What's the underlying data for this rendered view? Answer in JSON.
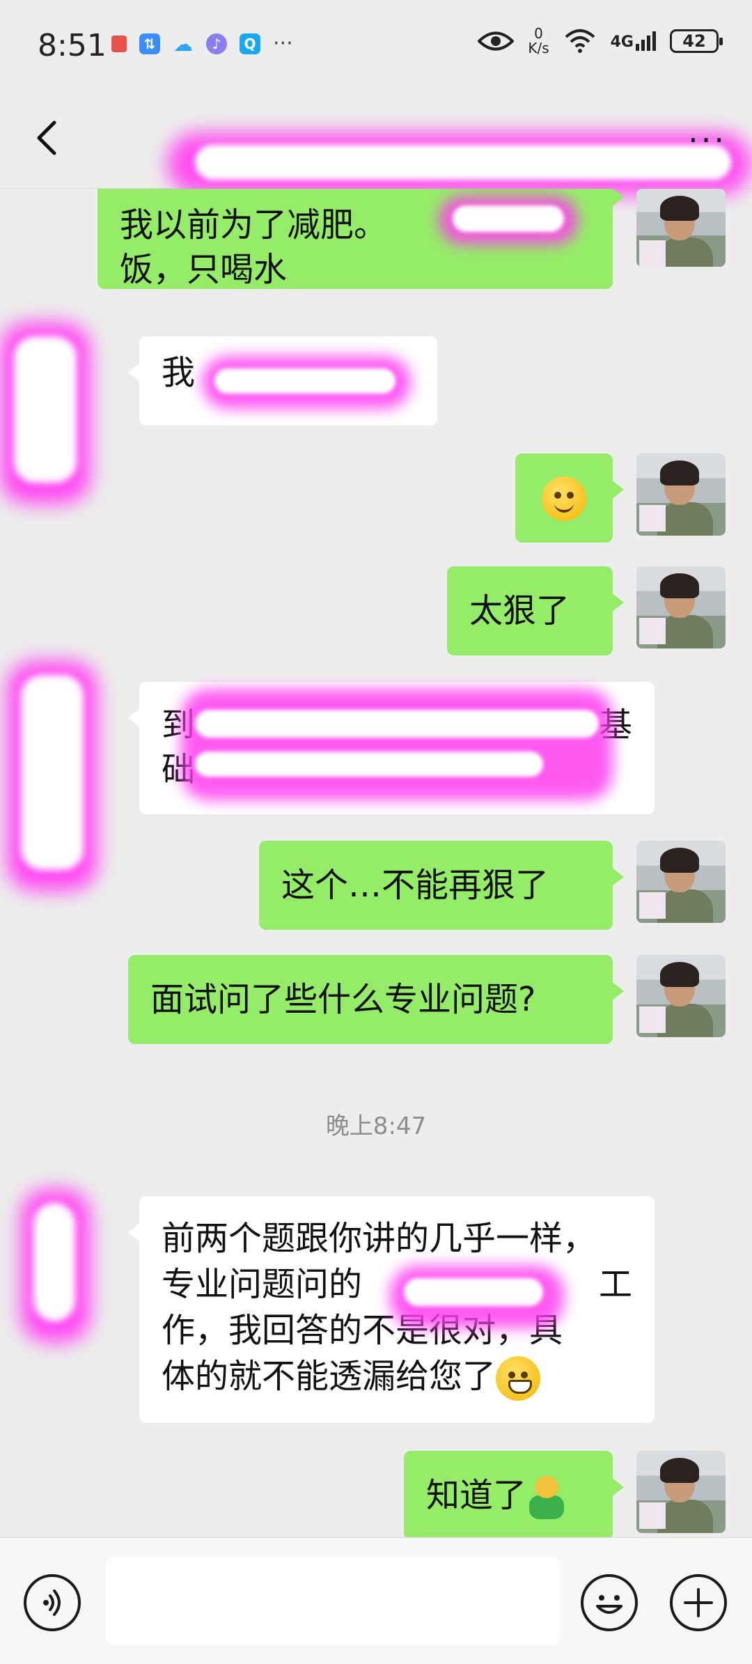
{
  "status_bar": {
    "time": "8:51",
    "net_speed_value": "0",
    "net_speed_unit": "K/s",
    "network_type": "4G",
    "battery": "42"
  },
  "nav": {
    "more_icon": "···"
  },
  "messages": [
    {
      "sender": "me",
      "text": "我以前为了减肥。",
      "text_line2": "饭，只喝水"
    },
    {
      "sender": "other",
      "text": "我"
    },
    {
      "sender": "me",
      "emoji": "smile-emoji"
    },
    {
      "sender": "me",
      "text": "太狠了"
    },
    {
      "sender": "other",
      "text_left": "到",
      "text_right": "基",
      "text_line2": "础"
    },
    {
      "sender": "me",
      "text": "这个…不能再狠了"
    },
    {
      "sender": "me",
      "text": "面试问了些什么专业问题?"
    },
    {
      "sender": "other",
      "line1": "前两个题跟你讲的几乎一样，",
      "line2": "专业问题问的",
      "line2_end": "工",
      "line3": "作，我回答的不是很对，具",
      "line4": "体的就不能透漏给您了",
      "emoji": "grin-emoji"
    },
    {
      "sender": "me",
      "text": "知道了",
      "emoji": "hug-emoji"
    }
  ],
  "timestamp": "晚上8:47",
  "input_bar": {
    "voice_icon": "voice-icon",
    "emoji_icon": "emoji-icon",
    "plus_icon": "plus-icon"
  },
  "colors": {
    "my_bubble": "#95ec69",
    "other_bubble": "#ffffff",
    "background": "#ededed",
    "redaction": "#ff3df0"
  }
}
